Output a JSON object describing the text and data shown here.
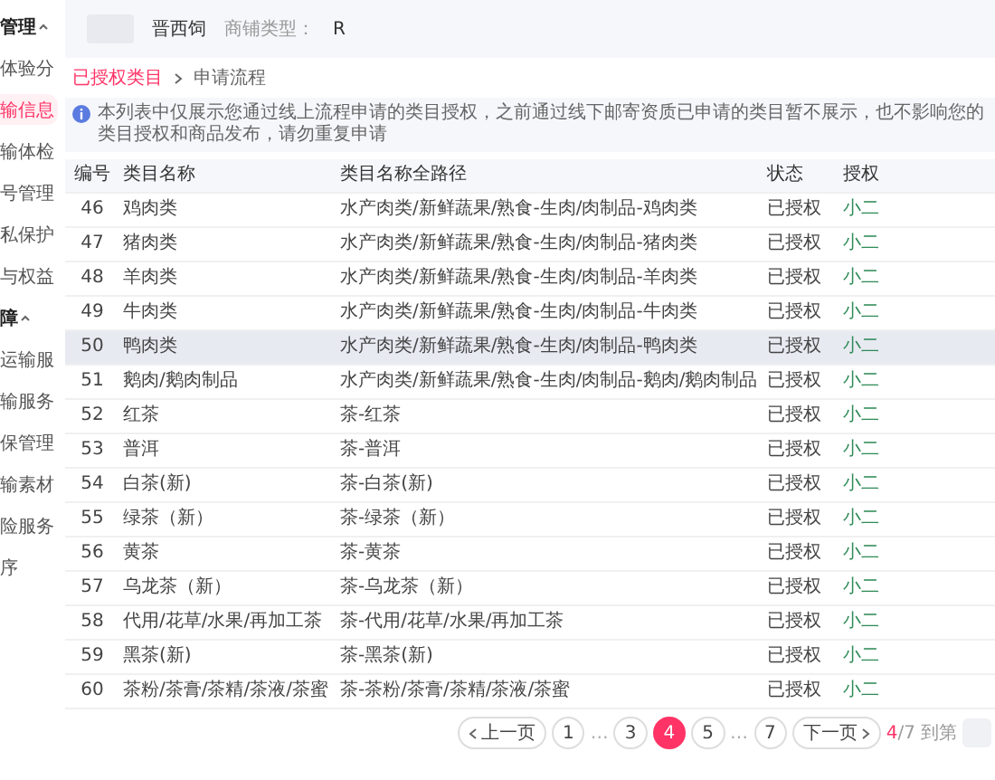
{
  "sidebar": {
    "items": [
      {
        "kind": "group",
        "label": "管理",
        "expanded": true,
        "selected": false
      },
      {
        "kind": "item",
        "label": "体验分",
        "selected": false
      },
      {
        "kind": "item",
        "label": "输信息",
        "selected": true
      },
      {
        "kind": "item",
        "label": "输体检",
        "selected": false
      },
      {
        "kind": "item",
        "label": "号管理",
        "selected": false
      },
      {
        "kind": "item",
        "label": "私保护",
        "selected": false
      },
      {
        "kind": "item",
        "label": "与权益",
        "selected": false
      },
      {
        "kind": "group",
        "label": "障",
        "expanded": true,
        "selected": false
      },
      {
        "kind": "item",
        "label": "运输服",
        "selected": false
      },
      {
        "kind": "item",
        "label": "输服务",
        "selected": false
      },
      {
        "kind": "item",
        "label": "保管理",
        "selected": false
      },
      {
        "kind": "item",
        "label": "输素材",
        "selected": false
      },
      {
        "kind": "item",
        "label": "险服务",
        "selected": false
      },
      {
        "kind": "item",
        "label": "序",
        "selected": false
      }
    ]
  },
  "header": {
    "shop_name": "晋西饲",
    "shop_type_label": "商铺类型：",
    "shop_type": "R"
  },
  "breadcrumb": [
    {
      "label": "已授权类目",
      "selected": true
    },
    {
      "label": "申请流程",
      "selected": false
    }
  ],
  "notice": "本列表中仅展示您通过线上流程申请的类目授权，之前通过线下邮寄资质已申请的类目暂不展示，也不影响您的类目授权和商品发布，请勿重复申请",
  "table": {
    "columns": [
      "编号",
      "类目名称",
      "类目名称全路径",
      "状态",
      "授权"
    ],
    "rows": [
      {
        "id": "46",
        "name": "鸡肉类",
        "path": "水产肉类/新鲜蔬果/熟食-生肉/肉制品-鸡肉类",
        "status": "已授权",
        "action": "小二",
        "hovered": false
      },
      {
        "id": "47",
        "name": "猪肉类",
        "path": "水产肉类/新鲜蔬果/熟食-生肉/肉制品-猪肉类",
        "status": "已授权",
        "action": "小二",
        "hovered": false
      },
      {
        "id": "48",
        "name": "羊肉类",
        "path": "水产肉类/新鲜蔬果/熟食-生肉/肉制品-羊肉类",
        "status": "已授权",
        "action": "小二",
        "hovered": false
      },
      {
        "id": "49",
        "name": "牛肉类",
        "path": "水产肉类/新鲜蔬果/熟食-生肉/肉制品-牛肉类",
        "status": "已授权",
        "action": "小二",
        "hovered": false
      },
      {
        "id": "50",
        "name": "鸭肉类",
        "path": "水产肉类/新鲜蔬果/熟食-生肉/肉制品-鸭肉类",
        "status": "已授权",
        "action": "小二",
        "hovered": true
      },
      {
        "id": "51",
        "name": "鹅肉/鹅肉制品",
        "path": "水产肉类/新鲜蔬果/熟食-生肉/肉制品-鹅肉/鹅肉制品",
        "status": "已授权",
        "action": "小二",
        "hovered": false
      },
      {
        "id": "52",
        "name": "红茶",
        "path": "茶-红茶",
        "status": "已授权",
        "action": "小二",
        "hovered": false
      },
      {
        "id": "53",
        "name": "普洱",
        "path": "茶-普洱",
        "status": "已授权",
        "action": "小二",
        "hovered": false
      },
      {
        "id": "54",
        "name": "白茶(新)",
        "path": "茶-白茶(新)",
        "status": "已授权",
        "action": "小二",
        "hovered": false
      },
      {
        "id": "55",
        "name": "绿茶（新）",
        "path": "茶-绿茶（新）",
        "status": "已授权",
        "action": "小二",
        "hovered": false
      },
      {
        "id": "56",
        "name": "黄茶",
        "path": "茶-黄茶",
        "status": "已授权",
        "action": "小二",
        "hovered": false
      },
      {
        "id": "57",
        "name": "乌龙茶（新）",
        "path": "茶-乌龙茶（新）",
        "status": "已授权",
        "action": "小二",
        "hovered": false
      },
      {
        "id": "58",
        "name": "代用/花草/水果/再加工茶",
        "path": "茶-代用/花草/水果/再加工茶",
        "status": "已授权",
        "action": "小二",
        "hovered": false
      },
      {
        "id": "59",
        "name": "黑茶(新)",
        "path": "茶-黑茶(新)",
        "status": "已授权",
        "action": "小二",
        "hovered": false
      },
      {
        "id": "60",
        "name": "茶粉/茶膏/茶精/茶液/茶蜜",
        "path": "茶-茶粉/茶膏/茶精/茶液/茶蜜",
        "status": "已授权",
        "action": "小二",
        "hovered": false
      }
    ]
  },
  "pagination": {
    "prev": "上一页",
    "next": "下一页",
    "pages": [
      {
        "kind": "page",
        "label": "1",
        "selected": false
      },
      {
        "kind": "ellipsis",
        "label": "…"
      },
      {
        "kind": "page",
        "label": "3",
        "selected": false
      },
      {
        "kind": "page",
        "label": "4",
        "selected": true
      },
      {
        "kind": "page",
        "label": "5",
        "selected": false
      },
      {
        "kind": "ellipsis",
        "label": "…"
      },
      {
        "kind": "page",
        "label": "7",
        "selected": false
      }
    ],
    "current": "4",
    "total": "/7",
    "goto_label": "到第"
  }
}
